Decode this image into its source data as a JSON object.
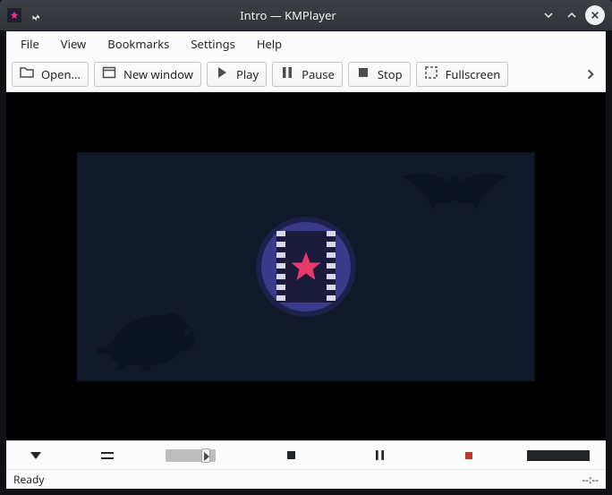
{
  "window": {
    "title": "Intro — KMPlayer"
  },
  "menubar": {
    "file": "File",
    "view": "View",
    "bookmarks": "Bookmarks",
    "settings": "Settings",
    "help": "Help"
  },
  "toolbar": {
    "open": "Open...",
    "new_window": "New window",
    "play": "Play",
    "pause": "Pause",
    "stop": "Stop",
    "fullscreen": "Fullscreen"
  },
  "status": {
    "text": "Ready",
    "time": "--:--"
  }
}
